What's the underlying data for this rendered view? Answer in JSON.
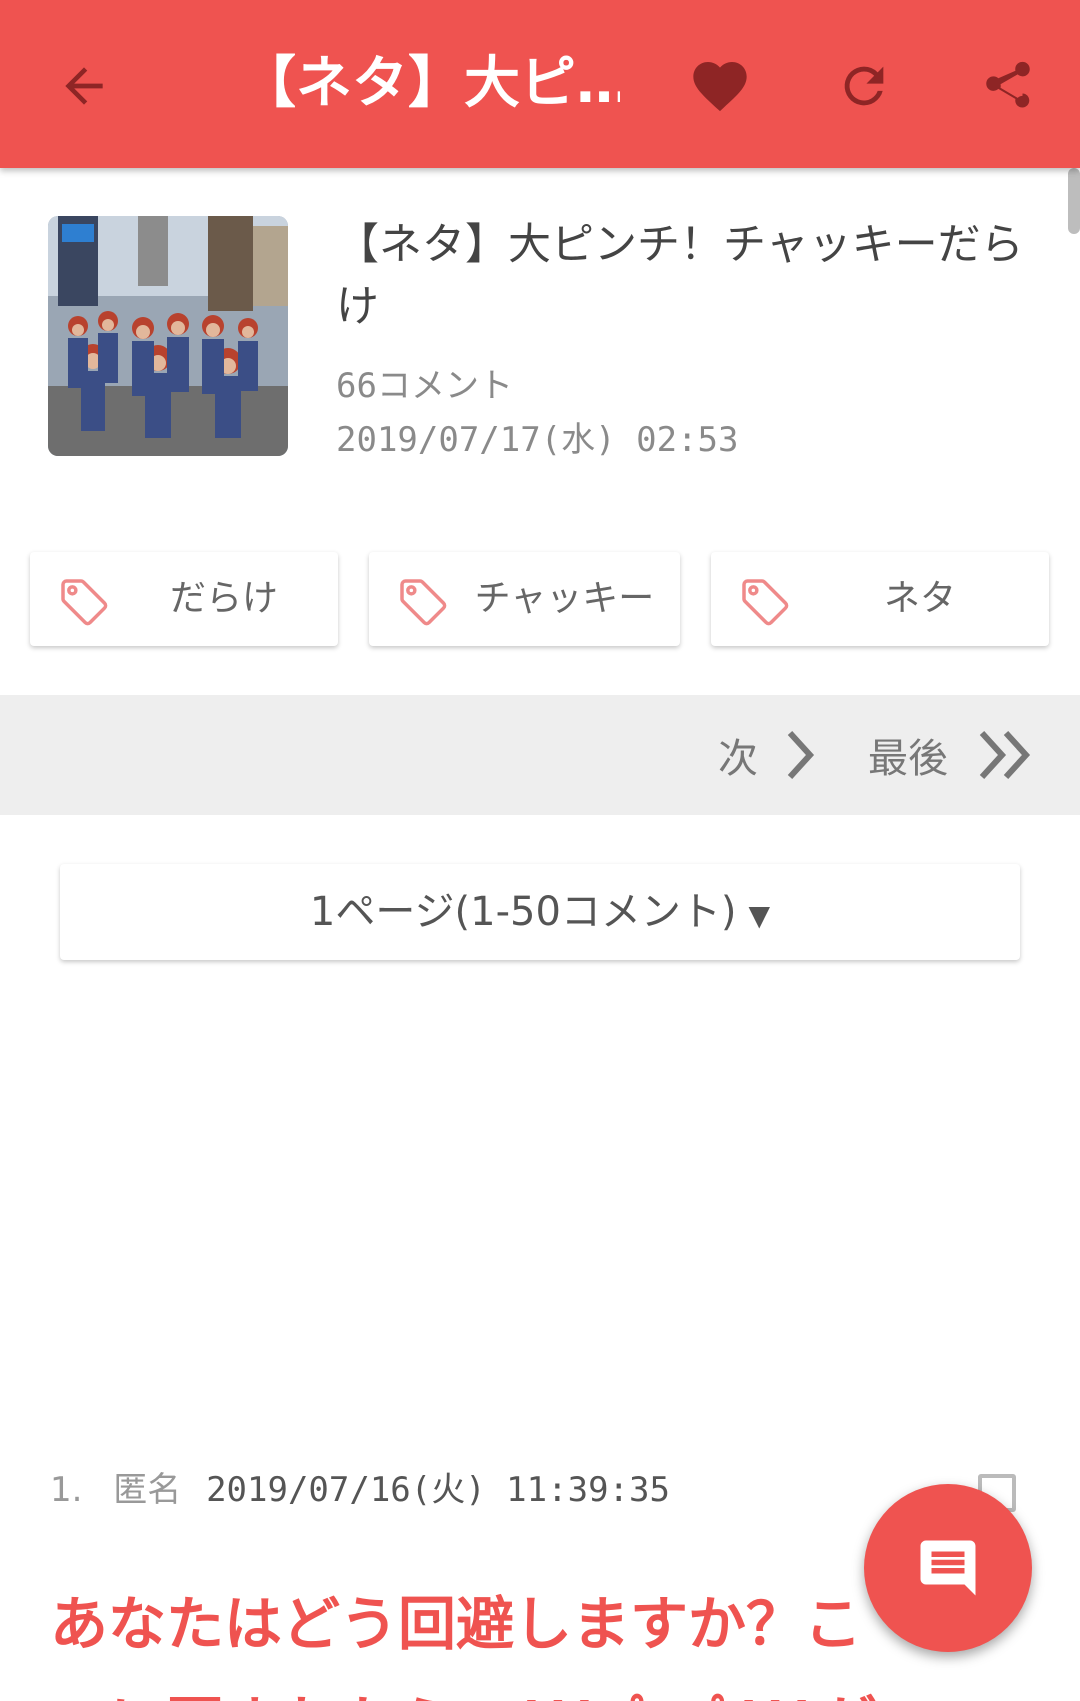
{
  "appbar": {
    "title": "【ネタ】大ピ…",
    "back_icon": "arrow-left-icon",
    "favorite_icon": "heart-icon",
    "refresh_icon": "refresh-icon",
    "share_icon": "share-icon"
  },
  "article": {
    "title": "【ネタ】大ピンチ！チャッキーだらけ",
    "comment_count": "66コメント",
    "date": "2019/07/17(水) 02:53"
  },
  "tags": [
    {
      "label": "だらけ"
    },
    {
      "label": "チャッキー"
    },
    {
      "label": "ネタ"
    }
  ],
  "pager": {
    "next_label": "次",
    "last_label": "最後"
  },
  "page_select": {
    "label": "1ページ(1-50コメント)",
    "caret": "▼"
  },
  "comment": {
    "number": "1.",
    "author": "匿名",
    "date": "2019/07/16(火) 11:39:35",
    "body": "あなたはどう回避しますか？こ",
    "body_line2": "のに囲まれたら…((( ;ﾟДﾟ)))が"
  },
  "colors": {
    "accent": "#ef5350",
    "icon_dark": "#8e2525"
  },
  "fab_icon": "comment-icon"
}
